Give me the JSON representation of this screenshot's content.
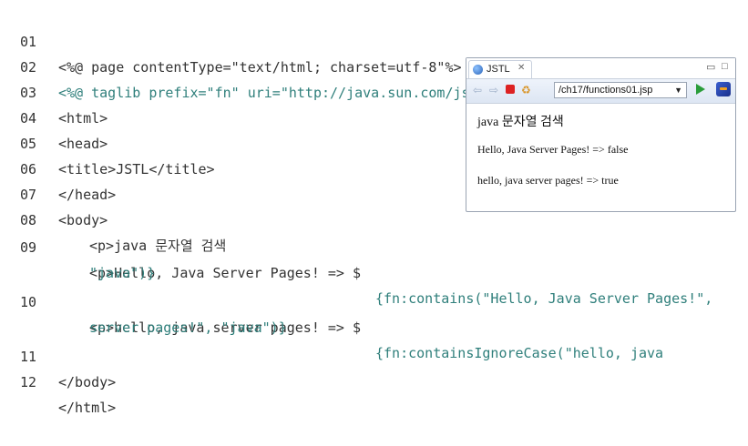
{
  "code_lines": [
    {
      "num": "01",
      "parts": [
        "<%@ page contentType=\"text/html; charset=utf-8\"%>"
      ]
    },
    {
      "num": "02",
      "parts": [
        "<%@ taglib prefix=\"fn\" uri=\"http://java.sun.com/jsp/jstl/functions\"%>"
      ]
    },
    {
      "num": "03",
      "parts": [
        "<html>"
      ]
    },
    {
      "num": "04",
      "parts": [
        "<head>"
      ]
    },
    {
      "num": "05",
      "parts": [
        "<title>JSTL</title>"
      ]
    },
    {
      "num": "06",
      "parts": [
        "</head>"
      ]
    },
    {
      "num": "07",
      "parts": [
        "<body>"
      ]
    },
    {
      "num": "08",
      "parts": [
        "<p>java 문자열 검색"
      ]
    },
    {
      "num": "09",
      "parts": [
        "<p>Hello, Java Server Pages! => $",
        "{fn:contains(\"Hello, Java Server Pages!\","
      ]
    },
    {
      "num": "",
      "parts": [
        "\"java\")}"
      ]
    },
    {
      "num": "10",
      "parts": [
        "<p>hello, java server pages! => $",
        "{fn:containsIgnoreCase(\"hello, java"
      ]
    },
    {
      "num": "",
      "parts": [
        "server pages!\", \"java\")}"
      ]
    },
    {
      "num": "11",
      "parts": [
        "</body>"
      ]
    },
    {
      "num": "12",
      "parts": [
        "</html>"
      ]
    }
  ],
  "browser": {
    "tab_label": "JSTL",
    "tab_close": "✕",
    "minimize": "▭",
    "maximize": "□",
    "url": "/ch17/functions01.jsp",
    "url_arrow": "▼",
    "output": [
      "java 문자열 검색",
      "Hello, Java Server Pages! => false",
      "hello, java server pages! => true"
    ]
  }
}
